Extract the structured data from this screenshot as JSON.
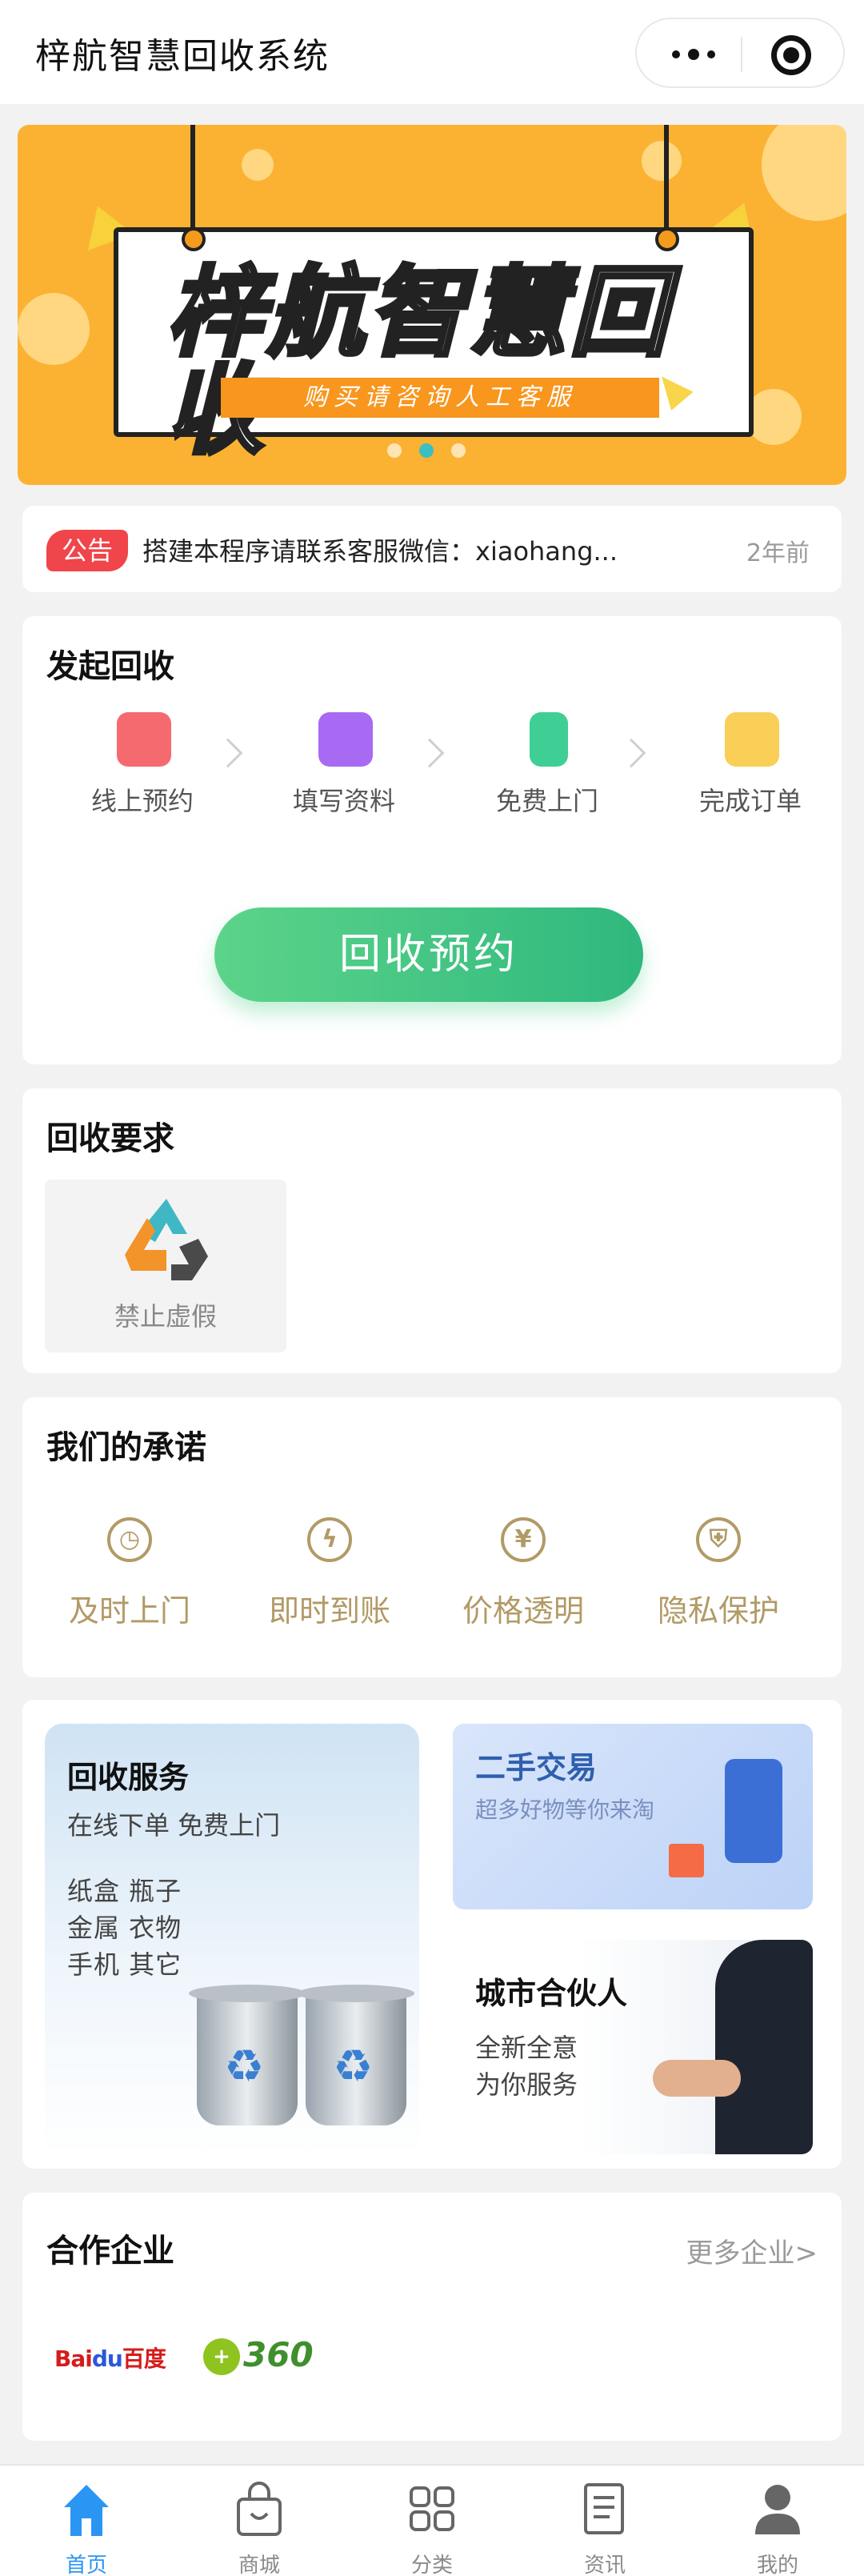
{
  "app": {
    "title": "梓航智慧回收系统"
  },
  "capsule": {
    "more_icon": "more-dots-icon",
    "close_icon": "mini-program-close-icon"
  },
  "banner": {
    "title": "梓航智慧回收",
    "subtitle": "购买请咨询人工客服",
    "slide_count": 3,
    "active_slide": 2
  },
  "notice": {
    "badge": "公告",
    "text": "搭建本程序请联系客服微信：xiaohang...",
    "time": "2年前"
  },
  "recycle_start": {
    "title": "发起回收",
    "steps": [
      {
        "label": "线上预约",
        "icon": "calendar-icon",
        "color": "#f0555a"
      },
      {
        "label": "填写资料",
        "icon": "form-icon",
        "color": "#9b59f0"
      },
      {
        "label": "免费上门",
        "icon": "door-icon",
        "color": "#2fc48a"
      },
      {
        "label": "完成订单",
        "icon": "order-done-icon",
        "color": "#f7c13d"
      }
    ],
    "button": "回收预约"
  },
  "requirements": {
    "title": "回收要求",
    "items": [
      {
        "label": "禁止虚假",
        "icon": "recycle-icon"
      }
    ]
  },
  "promises": {
    "title": "我们的承诺",
    "items": [
      {
        "label": "及时上门",
        "icon": "clock-icon",
        "glyph": "◷"
      },
      {
        "label": "即时到账",
        "icon": "lightning-icon",
        "glyph": "ϟ"
      },
      {
        "label": "价格透明",
        "icon": "yen-icon",
        "glyph": "¥"
      },
      {
        "label": "隐私保护",
        "icon": "shield-user-icon",
        "glyph": "⛨"
      }
    ]
  },
  "services": {
    "recycle": {
      "title": "回收服务",
      "subtitle": "在线下单 免费上门",
      "lines": [
        "纸盒  瓶子",
        "金属  衣物",
        "手机  其它"
      ]
    },
    "secondhand": {
      "title": "二手交易",
      "subtitle": "超多好物等你来淘"
    },
    "partner": {
      "title": "城市合伙人",
      "lines": [
        "全新全意",
        "为你服务"
      ]
    }
  },
  "partners": {
    "title": "合作企业",
    "more": "更多企业>",
    "logos": [
      {
        "name": "Baidu百度"
      },
      {
        "name": "360 www.360.cn"
      }
    ]
  },
  "tabbar": {
    "active": 0,
    "tabs": [
      {
        "label": "首页",
        "icon": "home-icon"
      },
      {
        "label": "商城",
        "icon": "shopping-bag-icon"
      },
      {
        "label": "分类",
        "icon": "category-grid-icon"
      },
      {
        "label": "资讯",
        "icon": "news-icon"
      },
      {
        "label": "我的",
        "icon": "user-icon"
      }
    ]
  },
  "colors": {
    "accent": "#2b95f3",
    "green": "#2fb87e",
    "gold": "#b29a66",
    "banner_bg": "#fbb233",
    "notice_red": "#f0454a"
  }
}
